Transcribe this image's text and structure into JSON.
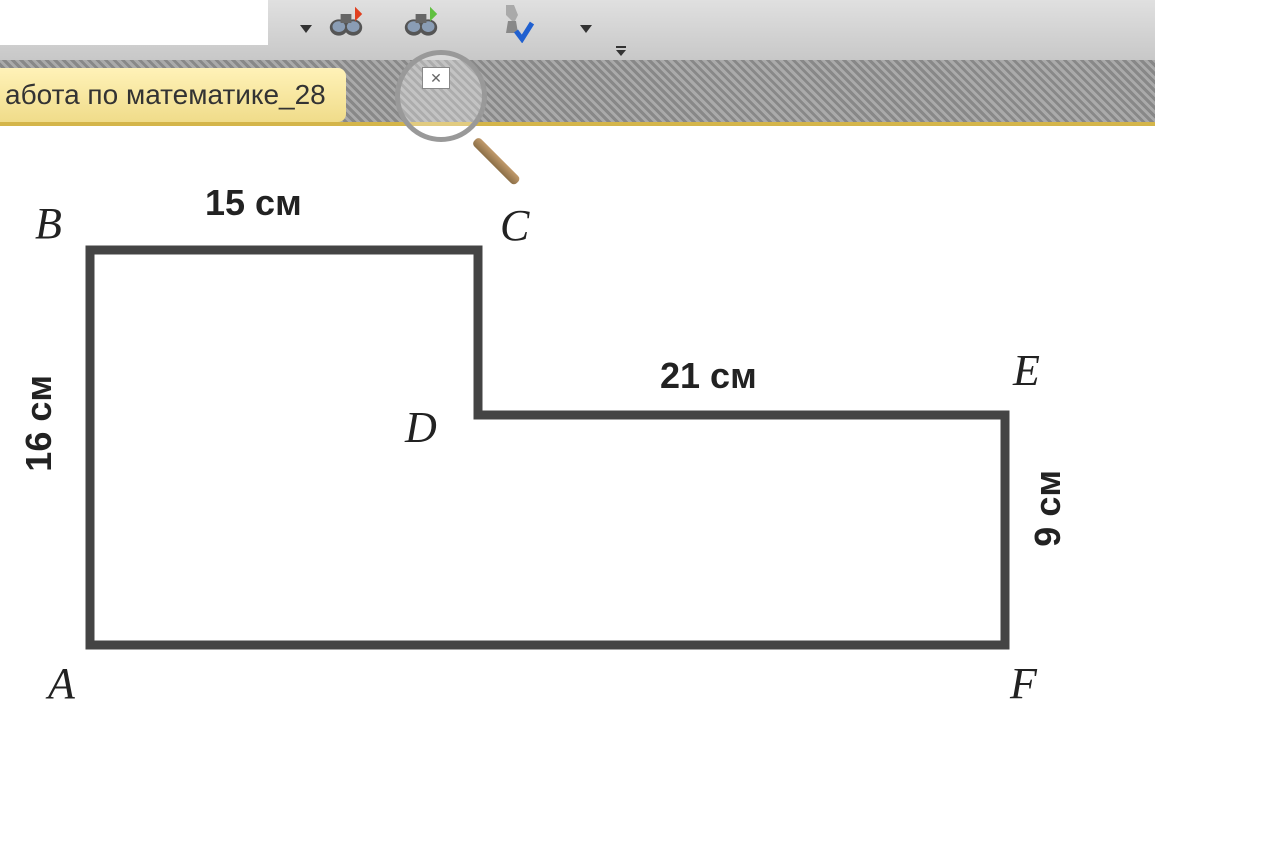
{
  "toolbar": {
    "file_tab_label": "абота по математике_28",
    "close_symbol": "✕"
  },
  "diagram": {
    "vertices": {
      "A": "A",
      "B": "B",
      "C": "C",
      "D": "D",
      "E": "E",
      "F": "F"
    },
    "dimensions": {
      "BC": "15 см",
      "AB": "16 см",
      "DE": "21 см",
      "EF": "9 см"
    }
  },
  "chart_data": {
    "type": "diagram",
    "shape": "L-shaped hexagon (step polygon)",
    "vertices": [
      {
        "name": "A",
        "description": "bottom-left"
      },
      {
        "name": "B",
        "description": "top-left"
      },
      {
        "name": "C",
        "description": "top, right of B"
      },
      {
        "name": "D",
        "description": "inner step corner"
      },
      {
        "name": "E",
        "description": "right, upper"
      },
      {
        "name": "F",
        "description": "bottom-right"
      }
    ],
    "labeled_sides": [
      {
        "from": "B",
        "to": "C",
        "length_cm": 15
      },
      {
        "from": "A",
        "to": "B",
        "length_cm": 16
      },
      {
        "from": "D",
        "to": "E",
        "length_cm": 21
      },
      {
        "from": "E",
        "to": "F",
        "length_cm": 9
      }
    ],
    "units": "см"
  }
}
